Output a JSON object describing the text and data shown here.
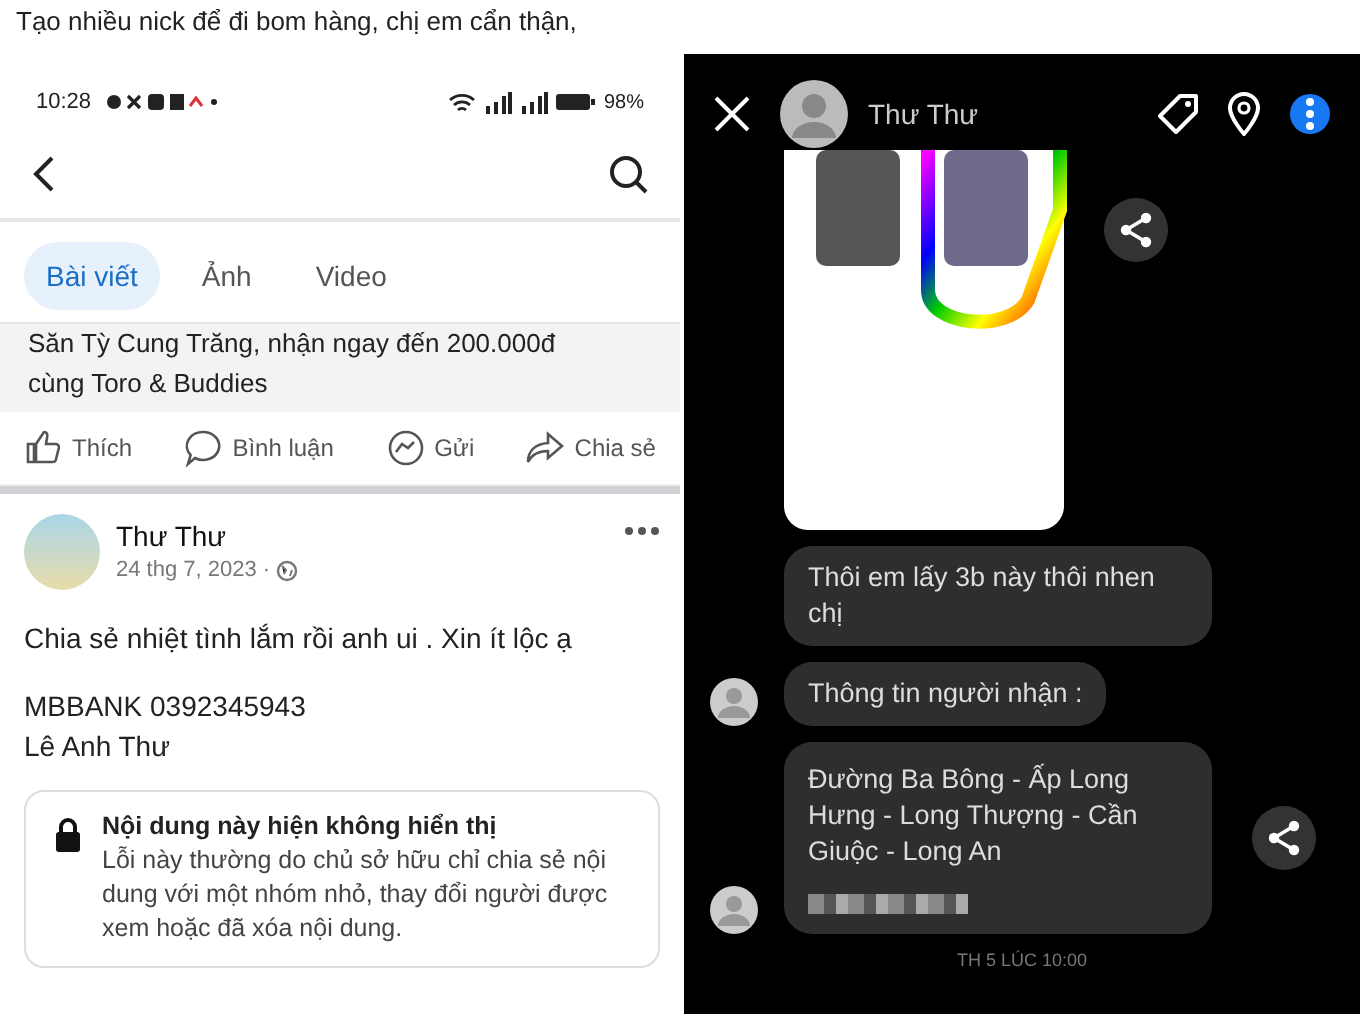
{
  "caption": "Tạo nhiều nick để đi bom hàng, chị em cẩn thận,",
  "profile_screen": {
    "status_bar": {
      "time": "10:28",
      "battery": "98%"
    },
    "tabs": [
      {
        "label": "Bài viết",
        "selected": true
      },
      {
        "label": "Ảnh",
        "selected": false
      },
      {
        "label": "Video",
        "selected": false
      }
    ],
    "previous_post_text": [
      "Săn Tỳ Cung Trăng, nhận ngay đến 200.000đ",
      "cùng Toro & Buddies"
    ],
    "actions": [
      {
        "kind": "like",
        "label": "Thích"
      },
      {
        "kind": "comment",
        "label": "Bình luận"
      },
      {
        "kind": "send",
        "label": "Gửi"
      },
      {
        "kind": "share",
        "label": "Chia sẻ"
      }
    ],
    "post": {
      "author": "Thư Thư",
      "date": "24 thg 7, 2023 ·",
      "paragraphs": [
        [
          "Chia sẻ nhiệt tình lắm rồi anh ui . Xin ít lộc ạ"
        ],
        [
          "MBBANK 0392345943",
          "Lê Anh Thư"
        ]
      ],
      "notice": {
        "title": "Nội dung này hiện không hiển thị",
        "body": "Lỗi này thường do chủ sở hữu chỉ chia sẻ nội dung với một nhóm nhỏ, thay đổi người được xem hoặc đã xóa nội dung."
      }
    }
  },
  "chat_screen": {
    "contact": "Thư Thư",
    "message_groups": [
      {
        "messages": [
          {
            "kind": "image"
          },
          {
            "kind": "text",
            "text": "Thôi em lấy 3b này thôi nhen chị"
          },
          {
            "kind": "text",
            "text": "Thông tin người nhận :"
          }
        ]
      },
      {
        "messages": [
          {
            "kind": "address",
            "text": "Đường Ba Bông - Ấp Long Hưng - Long Thượng - Cần Giuộc - Long An"
          }
        ]
      }
    ],
    "timestamp": "TH 5 LÚC 10:00"
  }
}
